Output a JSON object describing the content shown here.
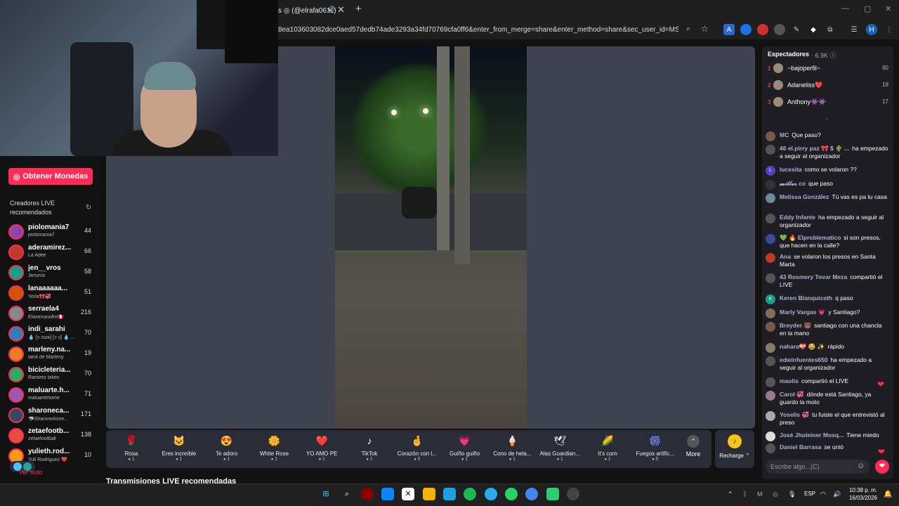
{
  "browser": {
    "tab_title": "s ◎ (@elrafa0611)",
    "url": "8ea103603082dce0aed57dedb74ade3293a34fd70769cfa0ff6&enter_from_merge=share&enter_method=share&sec_user_id=MS4wLjABA...",
    "profile_initial": "H"
  },
  "sidebar": {
    "coins_button": "Obtener Monedas",
    "recommended_title": "Creadores LIVE recomendados",
    "see_all": "Ver todo",
    "creators": [
      {
        "name": "piolomania7",
        "sub": "piolomania7",
        "count": "44"
      },
      {
        "name": "aderamirez...",
        "sub": "La Adee",
        "count": "66"
      },
      {
        "name": "jen__vros",
        "sub": "Jenvros",
        "count": "58"
      },
      {
        "name": "lanaaaaaa...",
        "sub": "Yorla🎀💞",
        "count": "51"
      },
      {
        "name": "serraela4",
        "sub": "Elaserranofre🇵🇪",
        "count": "216"
      },
      {
        "name": "indi_sarahi",
        "sub": "💧 [ɔ ɔɯɐ] [ɔ ɔ] 💧 ...",
        "count": "70"
      },
      {
        "name": "marleny.na...",
        "sub": "tarot de Marleny",
        "count": "19"
      },
      {
        "name": "bicicleteria...",
        "sub": "Ramirez bikes",
        "count": "70"
      },
      {
        "name": "maluarte.h...",
        "sub": "maluartehome",
        "count": "71"
      },
      {
        "name": "sharoneca...",
        "sub": "🦈SharoneAsmr...",
        "count": "171"
      },
      {
        "name": "zetaefootb...",
        "sub": "zetaefootball",
        "count": "138"
      },
      {
        "name": "yulieth.rod...",
        "sub": "Yuli Rodriguez ❤️",
        "count": "10"
      }
    ]
  },
  "gifts": [
    {
      "name": "Rosa",
      "price": "1",
      "icon": "🌹"
    },
    {
      "name": "Eres increíble",
      "price": "1",
      "icon": "🐱"
    },
    {
      "name": "Te adoro",
      "price": "1",
      "icon": "😍"
    },
    {
      "name": "White Rose",
      "price": "1",
      "icon": "🌼"
    },
    {
      "name": "YO AMO PE",
      "price": "1",
      "icon": "❤️"
    },
    {
      "name": "TikTok",
      "price": "1",
      "icon": "♪"
    },
    {
      "name": "Corazón con l...",
      "price": "5",
      "icon": "🤞"
    },
    {
      "name": "Guiño guiño",
      "price": "1",
      "icon": "💗"
    },
    {
      "name": "Cono de hela...",
      "price": "1",
      "icon": "🍦"
    },
    {
      "name": "Alas Guardian...",
      "price": "1",
      "icon": "🕊"
    },
    {
      "name": "It's corn",
      "price": "1",
      "icon": "🌽"
    },
    {
      "name": "Fuegos artific...",
      "price": "5",
      "icon": "🎆"
    }
  ],
  "gift_more": "More",
  "recharge": "Recharge",
  "section_title": "Transmisiones LIVE recomendadas",
  "spectators": {
    "title": "Espectadores",
    "count": "· 6.9K",
    "top": [
      {
        "rank": "1",
        "name": "~bajoperfil~",
        "score": "60"
      },
      {
        "rank": "2",
        "name": "Adaneliss❤️",
        "score": "19"
      },
      {
        "rank": "3",
        "name": "Anthony👾👾",
        "score": "17"
      }
    ]
  },
  "chat": [
    {
      "user": "MC",
      "text": "Que paso?",
      "av": ""
    },
    {
      "user": "46 el.pirry paz 🎀 $ 🌵 ...",
      "text": "ha empezado a seguir al organizador",
      "av": ""
    },
    {
      "user": "lucesita",
      "text": "como se volaron ??",
      "av": "L"
    },
    {
      "user": "𝓶𝓲𝓵𝓵𝓮𝓻 co",
      "text": "que paso",
      "av": ""
    },
    {
      "user": "Melissa González",
      "text": "Tú vas es pa tu casa",
      "av": ""
    },
    {
      "user": "Eddy Infante",
      "text": "ha empezado a seguir al organizador",
      "av": ""
    },
    {
      "user": "💚 🔥 Elproblematico",
      "text": "si son presos, que hacen en la calle?",
      "av": ""
    },
    {
      "user": "Ana",
      "text": "se volaron los presos en Santa Marta",
      "av": ""
    },
    {
      "user": "43 Rosmery Tovar Meza",
      "text": "compartió el LIVE",
      "av": ""
    },
    {
      "user": "Keren Blanquiceth",
      "text": "q paso",
      "av": "K"
    },
    {
      "user": "Marly Vargas 💗",
      "text": "y Santiago?",
      "av": ""
    },
    {
      "user": "Breyder 🐻",
      "text": "santiago con una chancla en la mano",
      "av": ""
    },
    {
      "user": "nahara💝 😂 ✨",
      "text": "rápido",
      "av": ""
    },
    {
      "user": "edwinfuentes650",
      "text": "ha empezado a seguir al organizador",
      "av": ""
    },
    {
      "user": "maolis",
      "text": "compartió el LIVE",
      "av": ""
    },
    {
      "user": "Carol 💞",
      "text": "dónde está Santiago, ya guardo la moto",
      "av": ""
    },
    {
      "user": "Yoselis 💞",
      "text": "tu fuiste el que entrevistó al preso",
      "av": ""
    },
    {
      "user": "José Jholeiner Mosq...",
      "text": "Tiene miedo",
      "av": ""
    },
    {
      "user": "Daniel Barrasa",
      "text": "se unió",
      "av": ""
    }
  ],
  "chat_input_placeholder": "Escribe algo...(C)",
  "taskbar": {
    "lang": "ESP",
    "time": "10:38 p. m.",
    "date": "16/03/2026"
  }
}
